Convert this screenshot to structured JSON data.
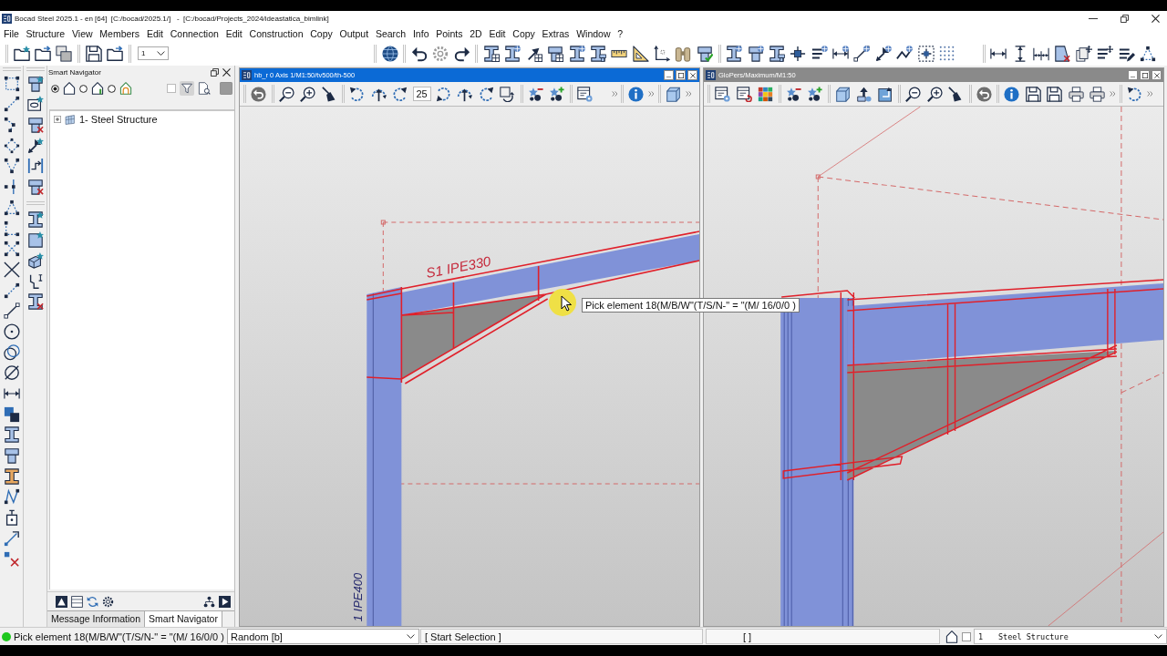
{
  "window": {
    "title": "Bocad Steel 2025.1 - en [64]  [C:/bocad/2025.1/]   -  [C:/bocad/Projects_2024/ideastatica_bimlink]"
  },
  "menu": [
    "File",
    "Structure",
    "View",
    "Members",
    "Edit",
    "Connection",
    "Edit",
    "Construction",
    "Copy",
    "Output",
    "Search",
    "Info",
    "Points",
    "2D",
    "Edit",
    "Copy",
    "Extras",
    "Window",
    "?"
  ],
  "toolbar": {
    "layer_select": "1"
  },
  "smart_navigator": {
    "title": "Smart Navigator",
    "view_options": [
      {
        "selected": true
      },
      {
        "selected": false
      },
      {
        "selected": false
      }
    ],
    "filter_checkbox": {
      "checked": false
    },
    "filter_on": true,
    "tree": [
      {
        "label": "1- Steel Structure",
        "expanded": false
      }
    ],
    "tabs": [
      {
        "label": "Message Information",
        "selected": false
      },
      {
        "label": "Smart Navigator",
        "selected": true
      }
    ]
  },
  "viewports": [
    {
      "kind": "axis_view",
      "title": "hb_r 0 Axis 1/M1:50/tv500/th-500",
      "active": true,
      "rotation_step": "25",
      "labels": [
        {
          "kind": "rafter",
          "text": "S1 IPE330"
        },
        {
          "kind": "column",
          "text": "1 IPE400"
        }
      ]
    },
    {
      "kind": "perspective_view",
      "title": "GloPers/Maximum/M1:50",
      "active": false
    }
  ],
  "tooltip": "Pick element 18(M/B/W\"(T/S/N-\" = \"(M/ 16/0/0 )",
  "status_bar": {
    "message": "Pick element 18(M/B/W\"(T/S/N-\" = \"(M/ 16/0/0 )",
    "selection_mode": "Random [b]",
    "selection_state": "[ Start Selection ]",
    "field_4": "[ ]",
    "layer_checkbox": {
      "checked": false
    },
    "layer_number": "1",
    "layer_name": "Steel Structure"
  }
}
